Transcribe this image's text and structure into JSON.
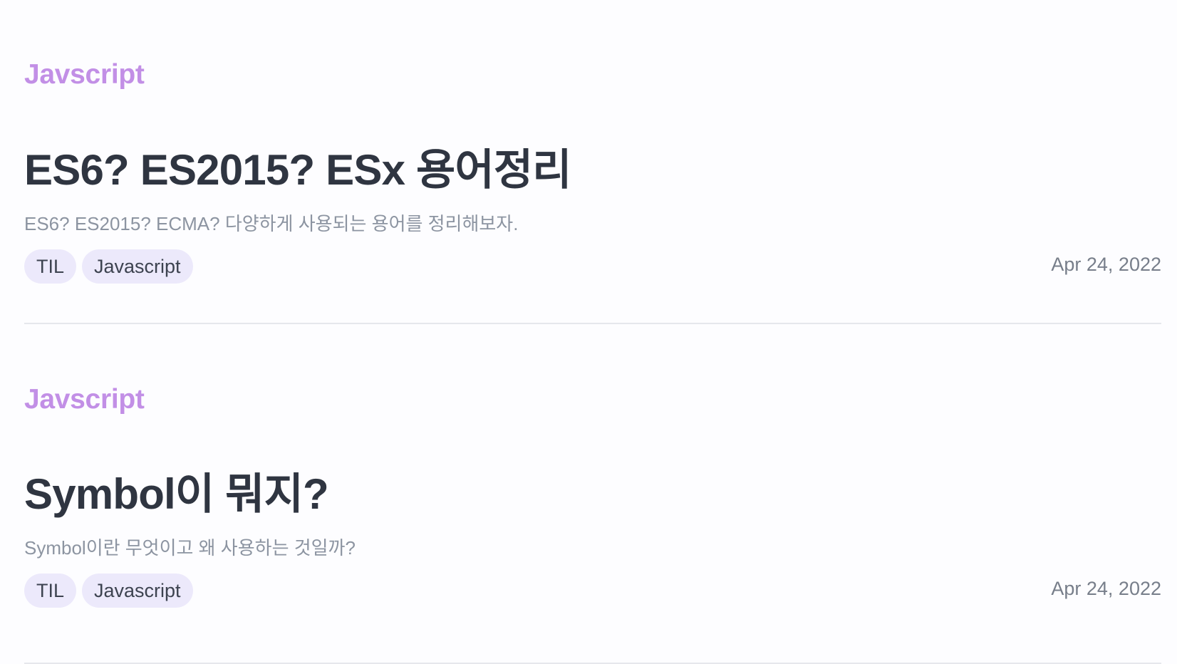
{
  "posts": [
    {
      "category": "Javscript",
      "title": "ES6? ES2015? ESx 용어정리",
      "description": "ES6? ES2015? ECMA? 다양하게 사용되는 용어를 정리해보자.",
      "tags": [
        "TIL",
        "Javascript"
      ],
      "date": "Apr 24, 2022"
    },
    {
      "category": "Javscript",
      "title": "Symbol이 뭐지?",
      "description": "Symbol이란 무엇이고 왜 사용하는 것일까?",
      "tags": [
        "TIL",
        "Javascript"
      ],
      "date": "Apr 24, 2022"
    }
  ],
  "colors": {
    "category": "#c28fe6",
    "title": "#2f3541",
    "description": "#8c94a1",
    "tag_bg": "#ece9fb",
    "date": "#777e8a",
    "divider": "#e6e7ec"
  }
}
